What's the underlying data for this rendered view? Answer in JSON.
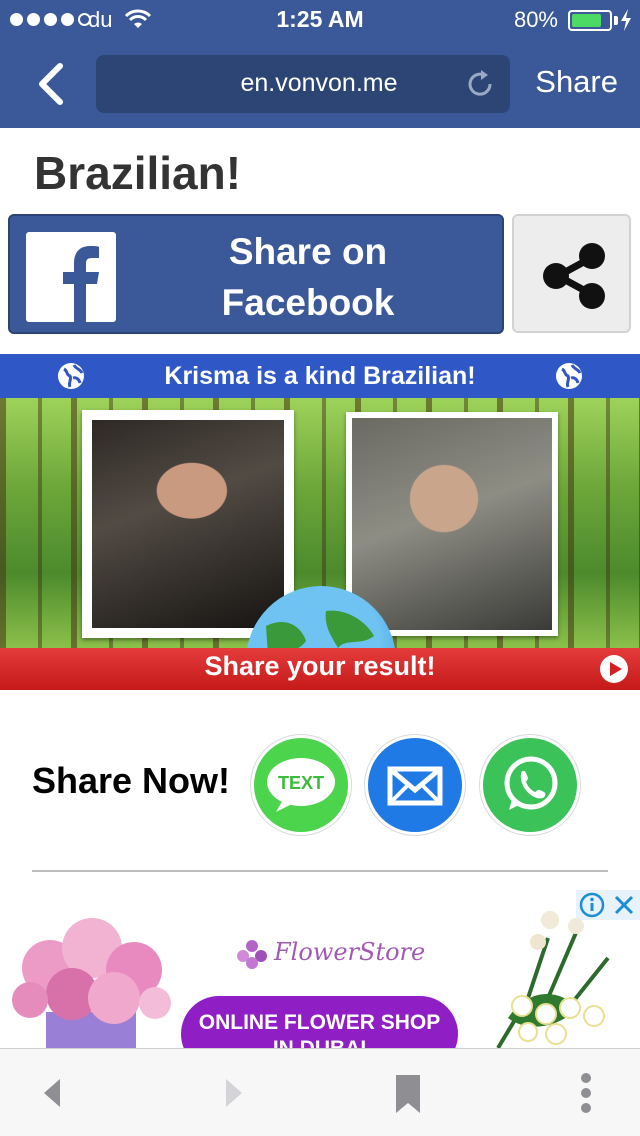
{
  "status_bar": {
    "carrier": "du",
    "time": "1:25 AM",
    "battery_percent": "80%",
    "battery_level": 0.8,
    "signal_dots_filled": 4,
    "signal_dots_total": 5
  },
  "nav": {
    "url": "en.vonvon.me",
    "share_label": "Share",
    "color": "#3b5998"
  },
  "page": {
    "title": "Brazilian!",
    "facebook_button": {
      "label_line1": "Share on",
      "label_line2": "Facebook"
    },
    "share_icon": "share-icon"
  },
  "banner": {
    "headline": "Krisma is a kind Brazilian!",
    "cta": "Share your result!"
  },
  "share_now": {
    "label": "Share Now!",
    "text_label": "TEXT",
    "buttons": [
      "text-message-icon",
      "mail-icon",
      "whatsapp-icon"
    ]
  },
  "ad": {
    "brand": "FlowerStore",
    "button_line1": "ONLINE FLOWER SHOP",
    "button_line2": "IN DUBAI"
  },
  "toolbar": {
    "items": [
      "back-arrow-icon",
      "forward-arrow-icon",
      "bookmark-icon",
      "more-icon"
    ]
  }
}
